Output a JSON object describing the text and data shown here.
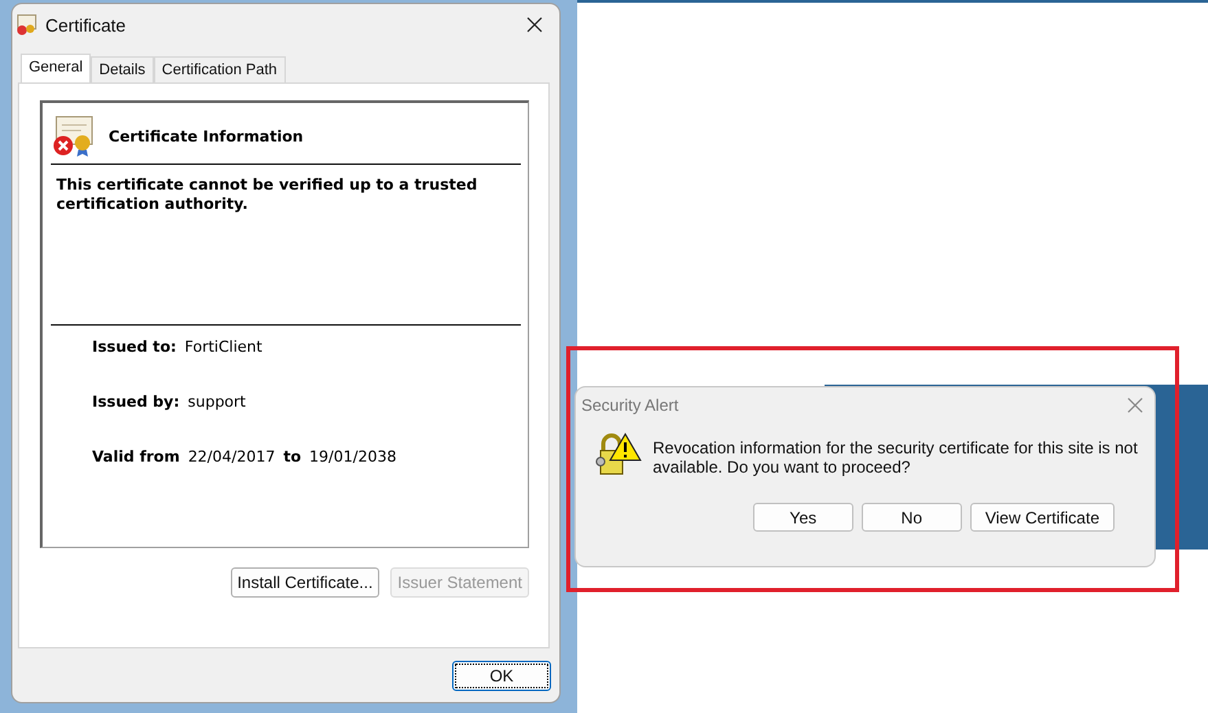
{
  "certificate_window": {
    "title": "Certificate",
    "tabs": [
      {
        "label": "General",
        "selected": true
      },
      {
        "label": "Details",
        "selected": false
      },
      {
        "label": "Certification Path",
        "selected": false
      }
    ],
    "heading": "Certificate Information",
    "message": "This certificate cannot be verified up to a trusted certification authority.",
    "issued_to_label": "Issued to:",
    "issued_to": "FortiClient",
    "issued_by_label": "Issued by:",
    "issued_by": "support",
    "valid_from_label": "Valid from",
    "valid_from": "22/04/2017",
    "valid_to_label": "to",
    "valid_to": "19/01/2038",
    "buttons": [
      {
        "label": "Install Certificate...",
        "disabled": false
      },
      {
        "label": "Issuer Statement",
        "disabled": true
      }
    ],
    "ok_button": {
      "label": "OK",
      "focused": true
    }
  },
  "security_alert": {
    "title": "Security Alert",
    "message": "Revocation information for the security certificate for this site is not available. Do you want to proceed?",
    "buttons": [
      {
        "label": "Yes"
      },
      {
        "label": "No"
      },
      {
        "label": "View Certificate"
      }
    ]
  }
}
